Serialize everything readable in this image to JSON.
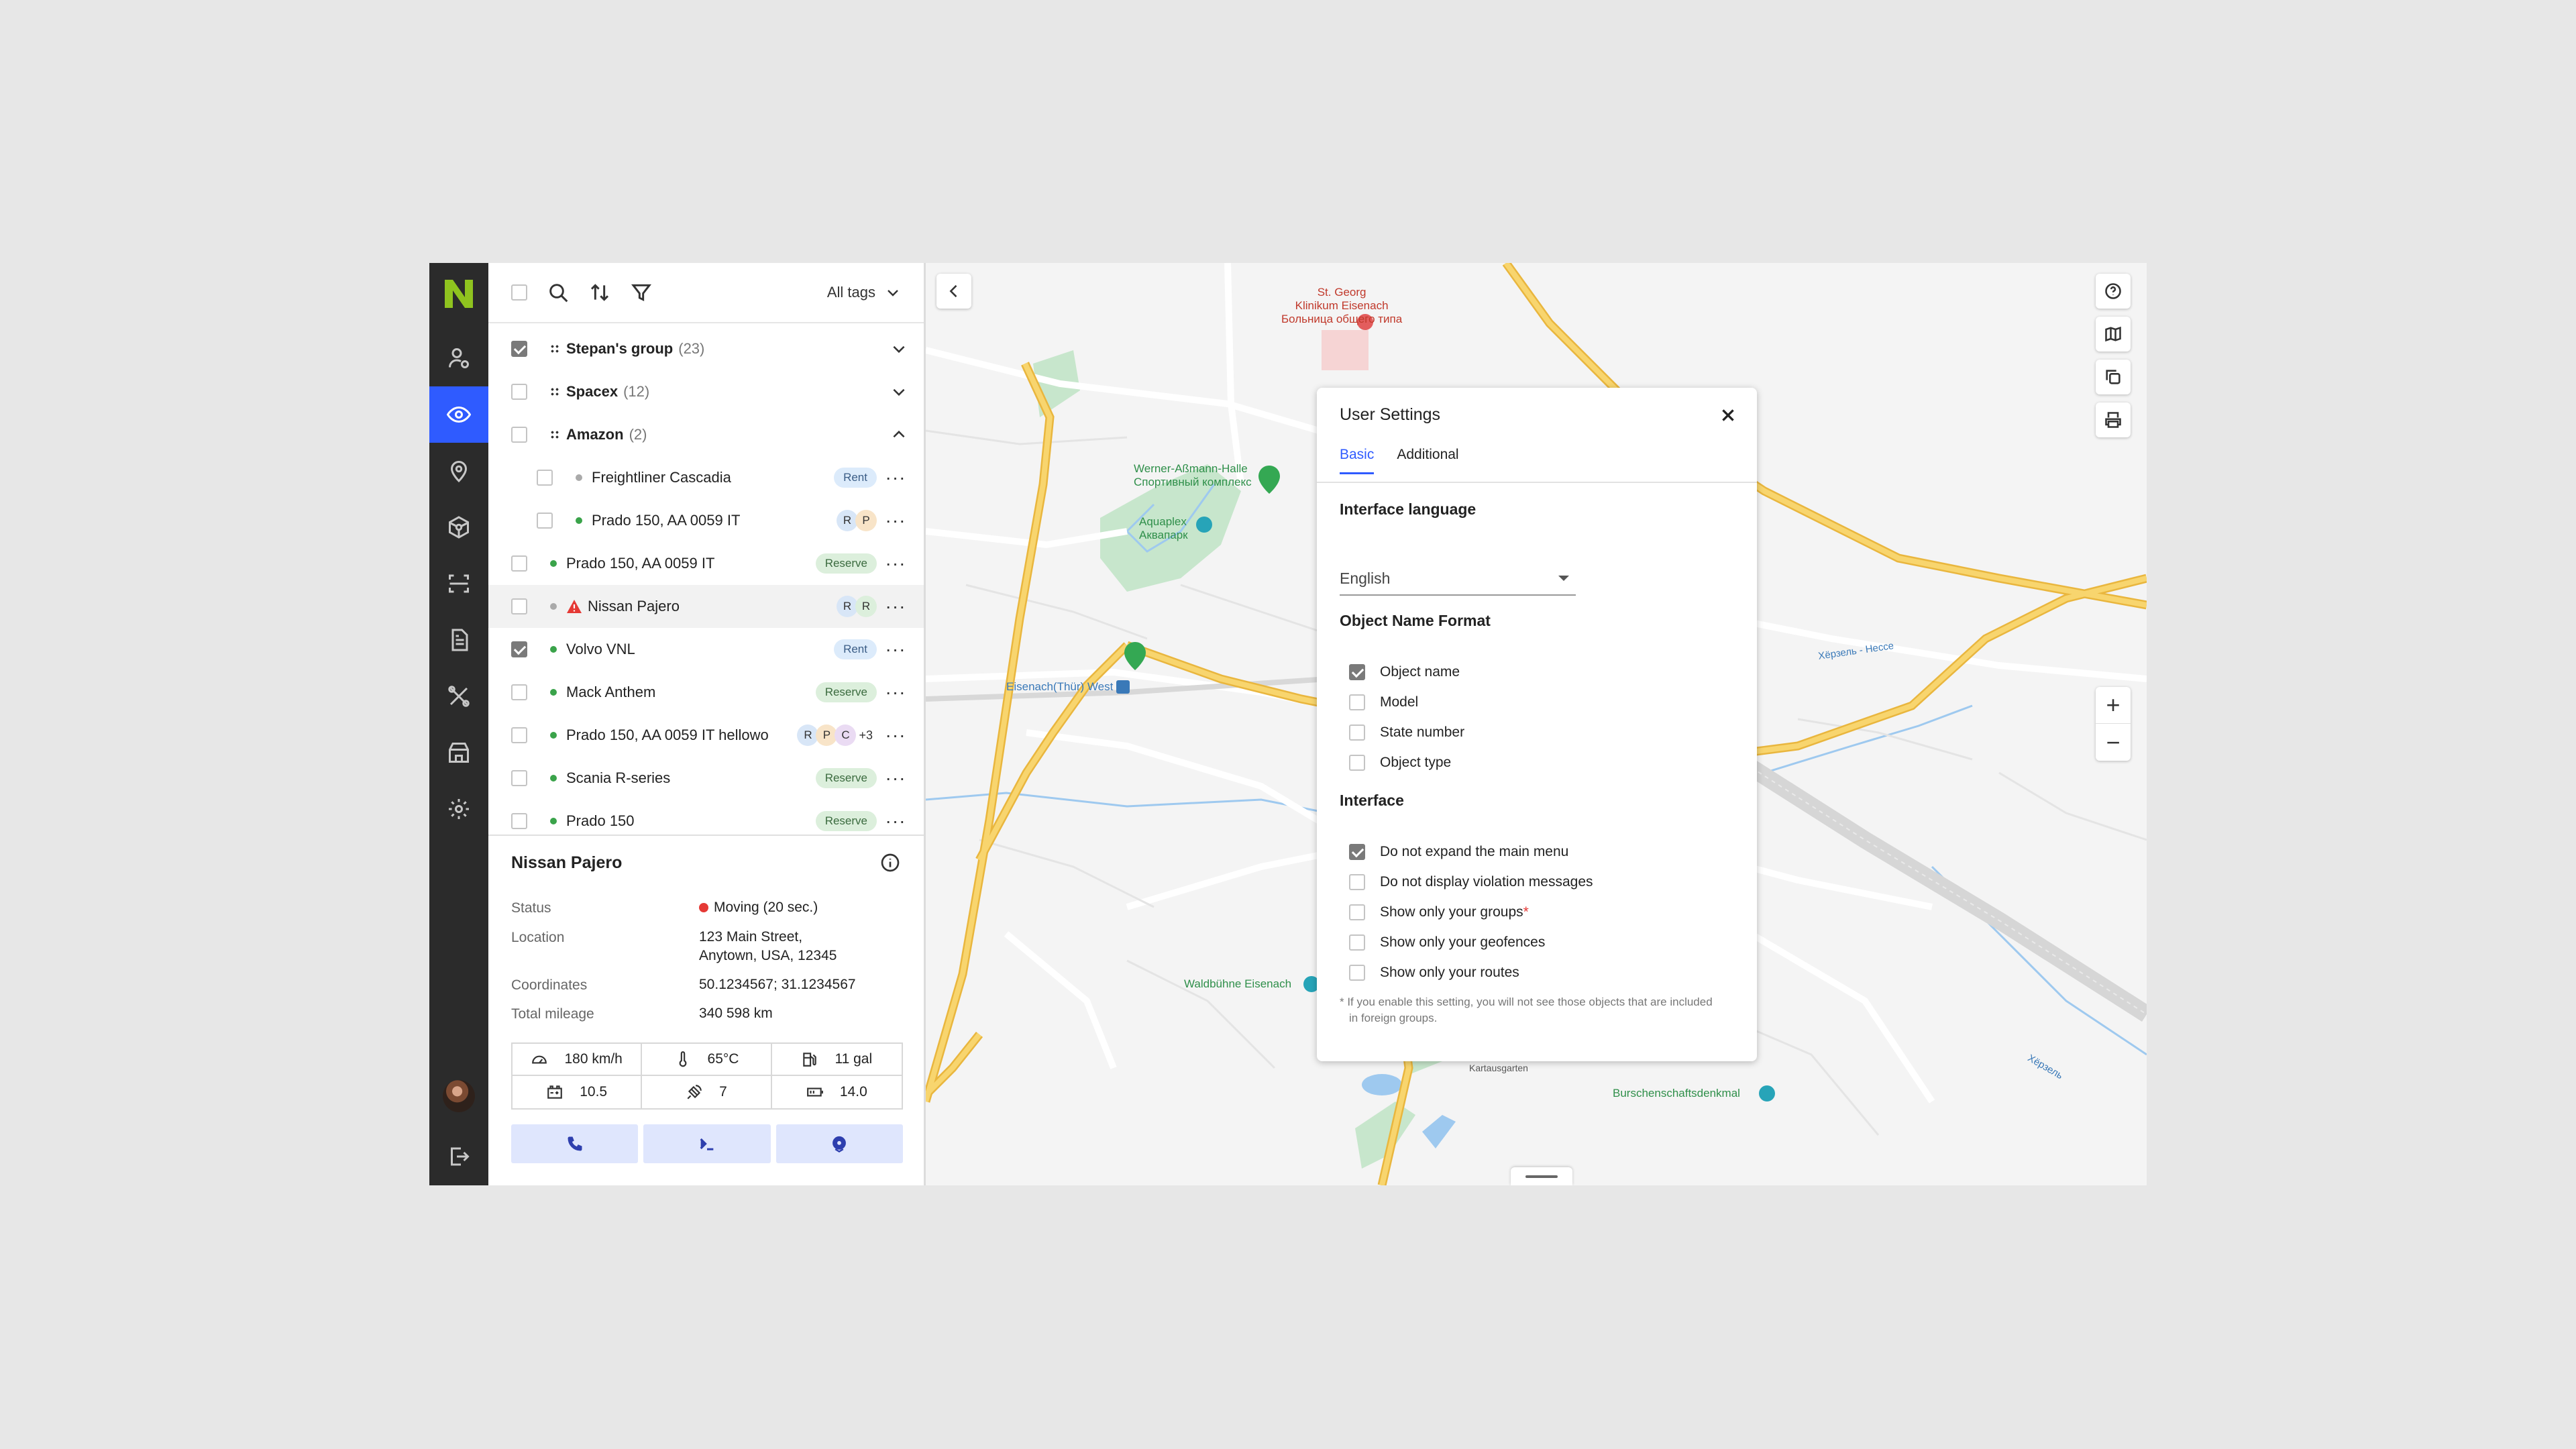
{
  "toolbar": {
    "all_tags_label": "All tags"
  },
  "groups": [
    {
      "name": "Stepan's group",
      "count": "(23)"
    },
    {
      "name": "Spacex",
      "count": "(12)"
    },
    {
      "name": "Amazon",
      "count": "(2)"
    }
  ],
  "objects": [
    {
      "name": "Freightliner Cascadia",
      "badge": "Rent"
    },
    {
      "name": "Prado 150, AA 0059 IT",
      "circles": [
        "R",
        "P"
      ]
    },
    {
      "name": "Prado 150, AA 0059 IT",
      "badge": "Reserve"
    },
    {
      "name": "Nissan Pajero",
      "circles": [
        "R",
        "R"
      ]
    },
    {
      "name": "Volvo VNL",
      "badge": "Rent"
    },
    {
      "name": "Mack Anthem",
      "badge": "Reserve"
    },
    {
      "name": "Prado 150, AA 0059 IT hellowo",
      "circles": [
        "R",
        "P",
        "C"
      ],
      "extra": "+3"
    },
    {
      "name": "Scania R-series",
      "badge": "Reserve"
    },
    {
      "name": "Prado 150",
      "badge": "Reserve"
    }
  ],
  "details": {
    "title": "Nissan Pajero",
    "status_label": "Status",
    "status_value": "Moving (20 sec.)",
    "location_label": "Location",
    "location_line1": "123 Main Street,",
    "location_line2": "Anytown, USA, 12345",
    "coordinates_label": "Coordinates",
    "coordinates_value": "50.1234567; 31.1234567",
    "mileage_label": "Total mileage",
    "mileage_value": "340 598 km",
    "stats": {
      "speed": "180 km/h",
      "temperature": "65°C",
      "fuel": "11 gal",
      "battery": "10.5",
      "satellites": "7",
      "voltage": "14.0"
    }
  },
  "map": {
    "labels": {
      "hospital": "St. Georg\nKlinikum Eisenach\nБольница общего типа",
      "hall": "Werner-Aßmann-Halle\nСпортивный комплекс",
      "aquaplex": "Aquaplex\nАквапарк",
      "station": "Eisenach(Thür) West",
      "waldbuhne": "Waldbühne Eisenach",
      "burschen": "Burschenschaftsdenkmal",
      "kartaus": "Kartausgarten",
      "river1": "Хёрзель - Нессе",
      "river2": "Хёрзель"
    }
  },
  "settings": {
    "title": "User Settings",
    "tab_basic": "Basic",
    "tab_additional": "Additional",
    "language_section": "Interface language",
    "language_value": "English",
    "format_section": "Object Name Format",
    "format_options": [
      {
        "label": "Object name",
        "checked": true
      },
      {
        "label": "Model",
        "checked": false
      },
      {
        "label": "State number",
        "checked": false
      },
      {
        "label": "Object type",
        "checked": false
      }
    ],
    "interface_section": "Interface",
    "interface_options": [
      {
        "label": "Do not expand the main menu",
        "checked": true
      },
      {
        "label": "Do not display violation messages",
        "checked": false
      },
      {
        "label": "Show only your groups",
        "checked": false
      },
      {
        "label": "Show only your geofences",
        "checked": false
      },
      {
        "label": "Show only your routes",
        "checked": false
      }
    ],
    "note": "* If you enable this setting, you will not see those objects that are included in foreign groups."
  },
  "colors": {
    "accent": "#2f5bff",
    "logo": "#8fc31f",
    "rail": "#2b2b2b",
    "road": "#f5c84c"
  }
}
